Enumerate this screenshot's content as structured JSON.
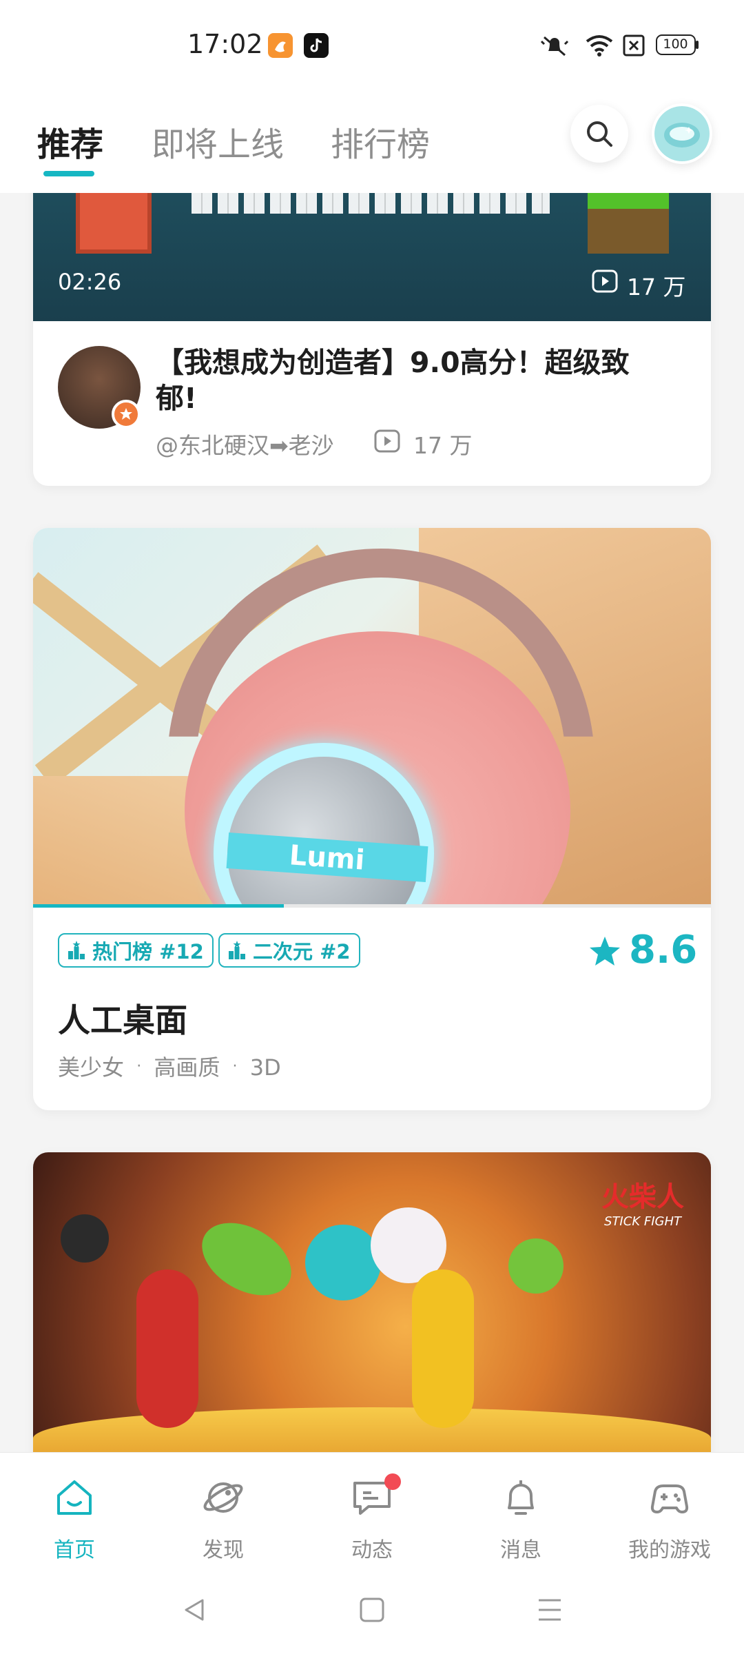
{
  "status_bar": {
    "time": "17:02",
    "battery": "100"
  },
  "header": {
    "tabs": [
      {
        "label": "推荐",
        "active": true
      },
      {
        "label": "即将上线",
        "active": false
      },
      {
        "label": "排行榜",
        "active": false
      }
    ]
  },
  "video_card": {
    "duration": "02:26",
    "views_overlay": "17 万",
    "title_line1": "【我想成为创造者】9.0高分！超级致",
    "title_line2": "郁!",
    "author": "@东北硬汉➡老沙",
    "views": "17 万"
  },
  "game_card": {
    "banner_text": "Lumi",
    "badges": [
      {
        "label": "热门榜 #12"
      },
      {
        "label": "二次元 #2"
      }
    ],
    "rating": "8.6",
    "title": "人工桌面",
    "tags": [
      "美少女",
      "高画质",
      "3D"
    ],
    "tag_separator": "·",
    "progress": 0.37
  },
  "game_card2": {
    "logo_text": "火柴人",
    "logo_sub": "STICK FIGHT"
  },
  "bottom_nav": [
    {
      "label": "首页",
      "icon": "home-icon",
      "active": true
    },
    {
      "label": "发现",
      "icon": "planet-icon",
      "active": false
    },
    {
      "label": "动态",
      "icon": "chat-icon",
      "active": false,
      "dot": true
    },
    {
      "label": "消息",
      "icon": "bell-icon",
      "active": false
    },
    {
      "label": "我的游戏",
      "icon": "gamepad-icon",
      "active": false
    }
  ],
  "colors": {
    "accent": "#16b7c3",
    "rating": "#1cb6c2",
    "notification_dot": "#f24b55"
  }
}
